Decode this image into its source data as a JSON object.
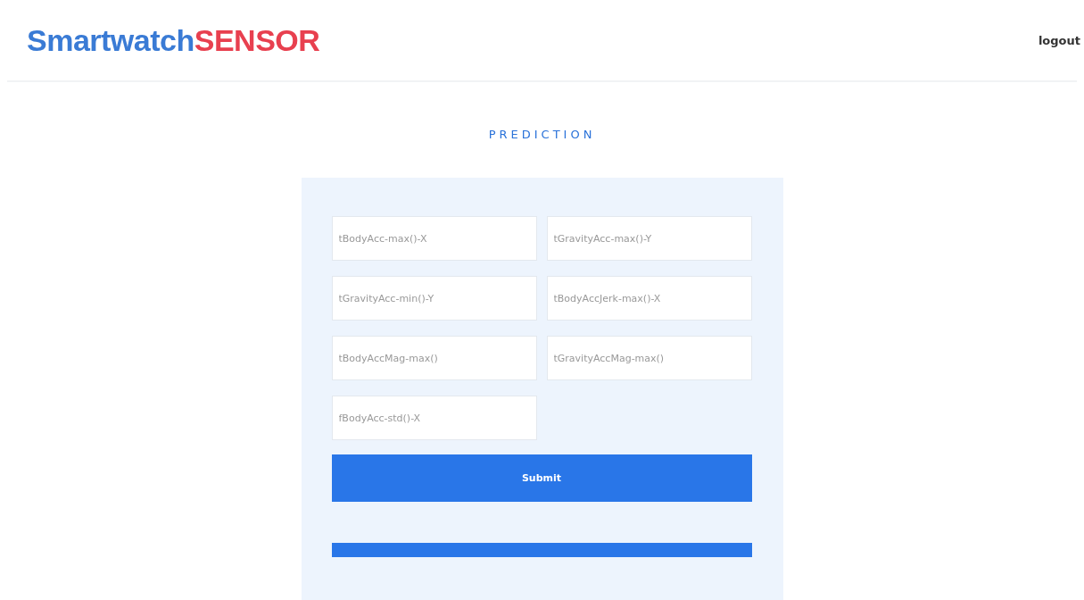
{
  "header": {
    "logo": {
      "primary": "Smartwatch",
      "accent": "SENSOR"
    },
    "nav": [
      {
        "label": "logout"
      }
    ]
  },
  "section_title": "PREDICTION",
  "form": {
    "fields": [
      {
        "placeholder": "tBodyAcc-max()-X"
      },
      {
        "placeholder": "tGravityAcc-max()-Y"
      },
      {
        "placeholder": "tGravityAcc-min()-Y"
      },
      {
        "placeholder": "tBodyAccJerk-max()-X"
      },
      {
        "placeholder": "tBodyAccMag-max()"
      },
      {
        "placeholder": "tGravityAccMag-max()"
      },
      {
        "placeholder": "fBodyAcc-std()-X"
      }
    ],
    "submit": "Submit",
    "result": {
      "kind": "bar"
    }
  }
}
